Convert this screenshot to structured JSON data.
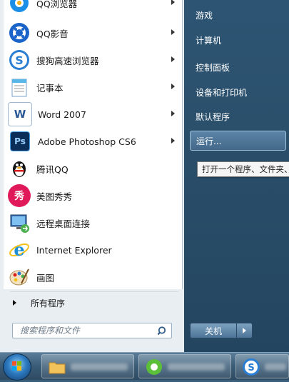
{
  "program_list": [
    {
      "label": "QQ浏览器",
      "icon": "qq-browser-icon",
      "has_submenu": true
    },
    {
      "label": "QQ影音",
      "icon": "qq-player-icon",
      "has_submenu": true
    },
    {
      "label": "搜狗高速浏览器",
      "icon": "sogou-browser-icon",
      "has_submenu": true
    },
    {
      "label": "记事本",
      "icon": "notepad-icon",
      "has_submenu": true
    },
    {
      "label": "Word 2007",
      "icon": "word-icon",
      "icon_text": "W",
      "has_submenu": true
    },
    {
      "label": "Adobe Photoshop CS6",
      "icon": "photoshop-icon",
      "icon_text": "Ps",
      "has_submenu": true
    },
    {
      "label": "腾讯QQ",
      "icon": "qq-penguin-icon",
      "has_submenu": false
    },
    {
      "label": "美图秀秀",
      "icon": "meitu-icon",
      "icon_text": "秀",
      "has_submenu": false
    },
    {
      "label": "远程桌面连接",
      "icon": "remote-desktop-icon",
      "has_submenu": false
    },
    {
      "label": "Internet Explorer",
      "icon": "internet-explorer-icon",
      "icon_text": "e",
      "has_submenu": false
    },
    {
      "label": "画图",
      "icon": "paint-icon",
      "has_submenu": false
    }
  ],
  "all_programs": "所有程序",
  "search": {
    "placeholder": "搜索程序和文件"
  },
  "right_menu": [
    "游戏",
    "计算机",
    "控制面板",
    "设备和打印机",
    "默认程序",
    "运行..."
  ],
  "tooltip": "打开一个程序、文件夹、",
  "shutdown": {
    "label": "关机"
  },
  "colors": {
    "accent_blue": "#2d5573",
    "photoshop": "#0b2e59",
    "word": "#2b5797",
    "meitu": "#e0195a",
    "ie": "#1e8fd6"
  }
}
